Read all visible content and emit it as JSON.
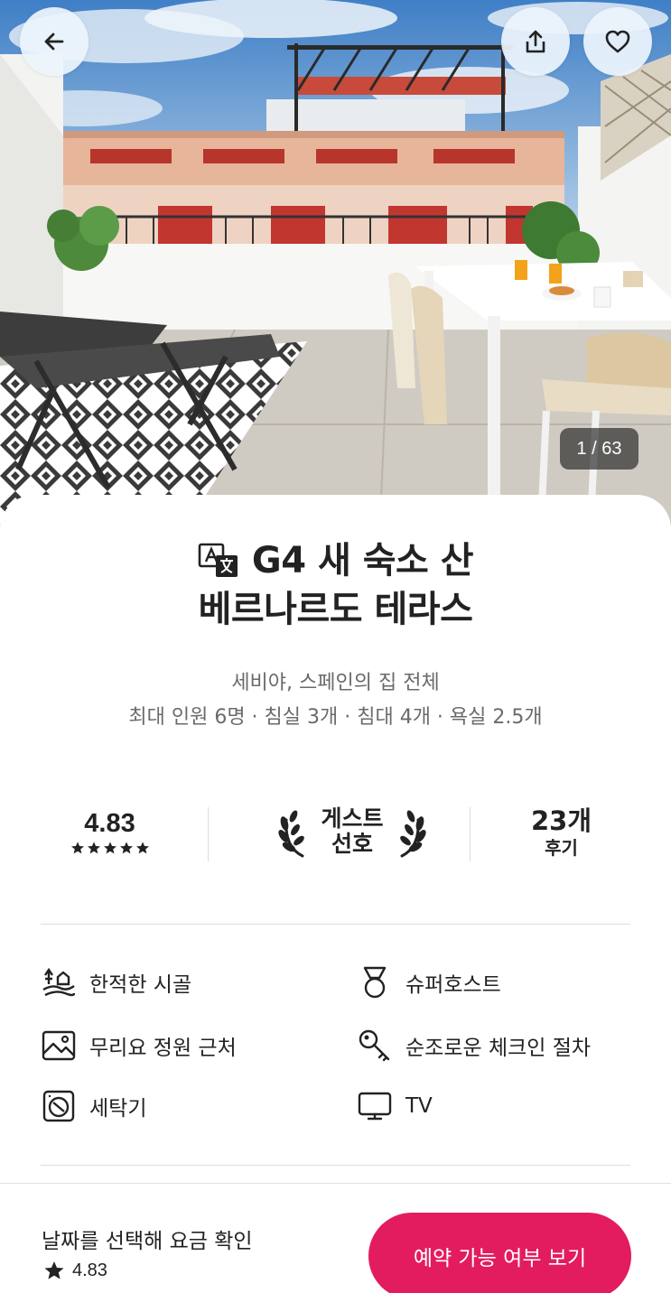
{
  "header": {
    "back_icon": "arrow-left-icon",
    "share_icon": "share-icon",
    "save_icon": "heart-icon",
    "photo_counter": "1 / 63"
  },
  "listing": {
    "title_line1": "G4 새 숙소 산",
    "title_line2": "베르나르도 테라스",
    "translate_icon": "translate-icon",
    "location": "세비야, 스페인의 집 전체",
    "details": "최대 인원 6명 · 침실 3개 · 침대 4개 · 욕실 2.5개"
  },
  "stats": {
    "rating": "4.83",
    "stars": 5,
    "guest_favorite_line1": "게스트",
    "guest_favorite_line2": "선호",
    "review_count": "23개",
    "review_label": "후기"
  },
  "amenities": [
    {
      "label": "한적한 시골",
      "icon": "countryside-icon"
    },
    {
      "label": "슈퍼호스트",
      "icon": "superhost-medal-icon"
    },
    {
      "label": "무리요 정원 근처",
      "icon": "image-icon"
    },
    {
      "label": "순조로운 체크인 절차",
      "icon": "key-icon"
    },
    {
      "label": "세탁기",
      "icon": "washer-icon"
    },
    {
      "label": "TV",
      "icon": "tv-icon"
    }
  ],
  "footer": {
    "price_prompt": "날짜를 선택해 요금 확인",
    "rating": "4.83",
    "reserve_label": "예약 가능 여부 보기"
  },
  "colors": {
    "accent": "#e31c5f",
    "text": "#222222",
    "muted": "#6a6a6a",
    "divider": "#dddddd"
  }
}
